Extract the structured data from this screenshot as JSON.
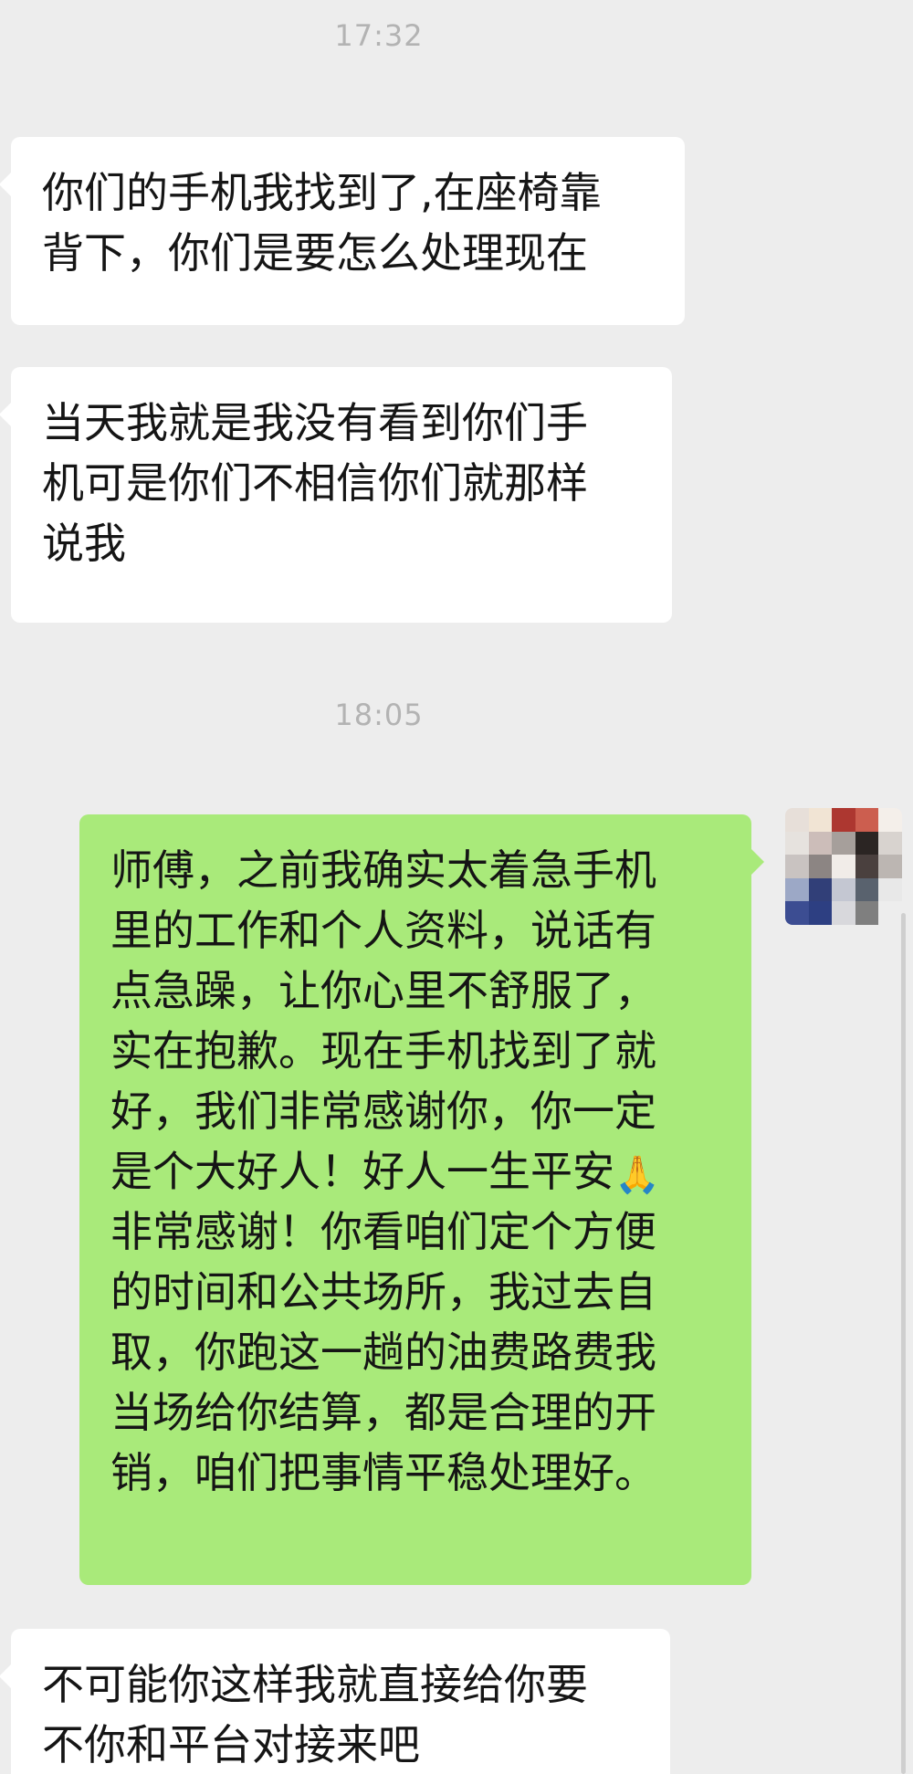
{
  "chat": {
    "timestamps": [
      "17:32",
      "18:05"
    ],
    "messages": [
      {
        "direction": "incoming",
        "lines": [
          "你们的手机我找到了,在座椅靠",
          "背下，你们是要怎么处理现在"
        ]
      },
      {
        "direction": "incoming",
        "lines": [
          "当天我就是我没有看到你们手",
          "机可是你们不相信你们就那样",
          "说我"
        ]
      },
      {
        "direction": "outgoing",
        "lines": [
          "师傅，之前我确实太着急手机",
          "里的工作和个人资料，说话有",
          "点急躁，让你心里不舒服了，",
          "实在抱歉。现在手机找到了就",
          "好，我们非常感谢你，你一定",
          "是个大好人！好人一生平安",
          "非常感谢！你看咱们定个方便",
          "的时间和公共场所，我过去自",
          "取，你跑这一趟的油费路费我",
          "当场给你结算，都是合理的开",
          "销，咱们把事情平稳处理好。"
        ],
        "emoji": "🙏"
      },
      {
        "direction": "incoming",
        "lines": [
          "不可能你这样我就直接给你要",
          "不你和平台对接来吧"
        ]
      }
    ]
  },
  "colors": {
    "background": "#ededed",
    "incoming_bubble": "#ffffff",
    "outgoing_bubble": "#a9ea7a",
    "timestamp_text": "#b3b3b3"
  },
  "icons": {
    "avatar": "pixelated-avatar",
    "prayer": "folded-hands-emoji"
  }
}
